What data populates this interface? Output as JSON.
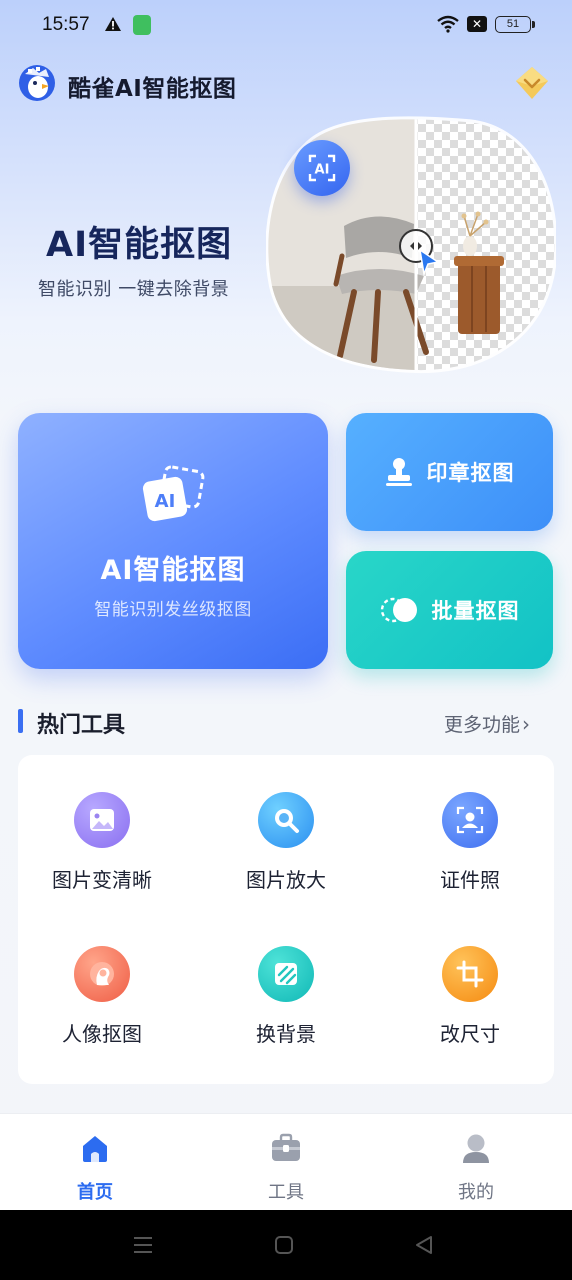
{
  "status_bar": {
    "time": "15:57",
    "battery": "51"
  },
  "header": {
    "app_title": "酷雀AI智能抠图"
  },
  "hero": {
    "title": "AI智能抠图",
    "subtitle": "智能识别  一键去除背景",
    "badge_text": "AI"
  },
  "cards": {
    "ai": {
      "title": "AI智能抠图",
      "subtitle": "智能识别发丝级抠图",
      "icon_text": "AI"
    },
    "stamp": {
      "label": "印章抠图"
    },
    "batch": {
      "label": "批量抠图"
    }
  },
  "hot_tools": {
    "title": "热门工具",
    "more": "更多功能",
    "items": [
      {
        "label": "图片变清晰",
        "icon": "image-icon",
        "color": "#9a84f0"
      },
      {
        "label": "图片放大",
        "icon": "magnifier-icon",
        "color": "#3aa8f5"
      },
      {
        "label": "证件照",
        "icon": "id-photo-icon",
        "color": "#4e80f0"
      },
      {
        "label": "人像抠图",
        "icon": "portrait-icon",
        "color": "#f57a5e"
      },
      {
        "label": "换背景",
        "icon": "swap-background-icon",
        "color": "#18c4bd"
      },
      {
        "label": "改尺寸",
        "icon": "crop-icon",
        "color": "#f89a1c"
      }
    ]
  },
  "bottom_nav": {
    "items": [
      {
        "label": "首页",
        "icon": "home-icon",
        "active": true
      },
      {
        "label": "工具",
        "icon": "toolbox-icon",
        "active": false
      },
      {
        "label": "我的",
        "icon": "profile-icon",
        "active": false
      }
    ]
  },
  "colors": {
    "accent": "#2c6cf0",
    "nav_inactive": "#7b8090",
    "title_dark": "#16265c"
  }
}
